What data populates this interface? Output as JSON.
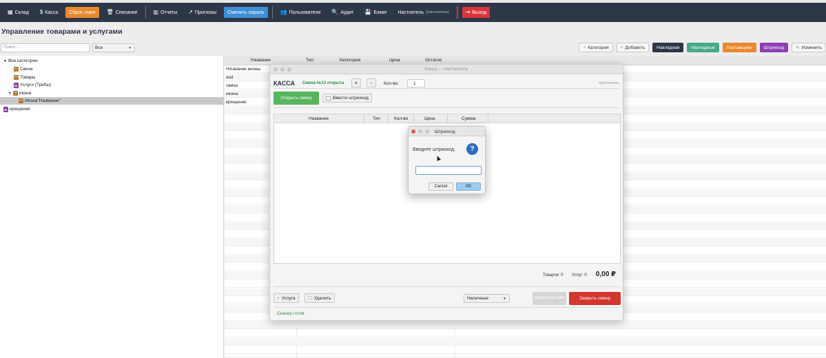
{
  "toolbar": {
    "warehouse": "Склад",
    "cashier": "Касса",
    "reset_shift": "Сброс смен",
    "writeoff": "Списание",
    "reports": "Отчеты",
    "forecasts": "Прогнозы",
    "change_password": "Сменить пароль",
    "users": "Пользователи",
    "audit": "Аудит",
    "backup": "Бэкап",
    "user_role": "Настоятель",
    "user_role_sub": "(Настоятель)",
    "logout": "Выход"
  },
  "page": {
    "title": "Управление товарами и услугами"
  },
  "filter": {
    "search_placeholder": "Поиск...",
    "scope_value": "Все"
  },
  "actions": {
    "category": "Категория",
    "add": "Добавить",
    "invoice_dark": "Накладная",
    "invoice_teal": "Накладные",
    "suppliers": "Поставщики",
    "barcode": "Штрихкод",
    "edit": "Изменить"
  },
  "tree": {
    "root": "Все категории",
    "items": [
      "Свечи",
      "Товары",
      "Услуги (Требы)",
      "икона",
      "Икона\"Название\"",
      "крещение"
    ]
  },
  "grid": {
    "columns": [
      "Название",
      "Тип",
      "Категория",
      "Цена",
      "Остаток"
    ],
    "rows": [
      "НАзвание иконы",
      "asd",
      "свеча",
      "икона",
      "крещение"
    ]
  },
  "kassa": {
    "window_title": "Касса — Настоятель",
    "brand": "КАССА",
    "shift_status": "Смена №13 открыта",
    "plus": "+",
    "minus": "-",
    "qty_label": "Кол-во:",
    "qty_value": "1",
    "user": "Настоятель",
    "open_shift": "Открыть смену",
    "enter_barcode": "Ввести штрихкод",
    "columns": [
      "Название",
      "Тип",
      "Кол-во",
      "Цена",
      "Сумма"
    ],
    "goods_count": "Товаров: 0",
    "services_count": "Услуг: 0",
    "total": "0,00 ₽",
    "service_btn": "Услуга",
    "delete_btn": "Удалить",
    "payment_method": "Наличные",
    "print_receipt": "Напечатать чек",
    "close_shift": "Закрыть смену",
    "status": "Сканер готов"
  },
  "dialog": {
    "title": "Штрихкод",
    "prompt": "Введите штрихкод",
    "cancel": "Cancel",
    "ok": "OK"
  }
}
